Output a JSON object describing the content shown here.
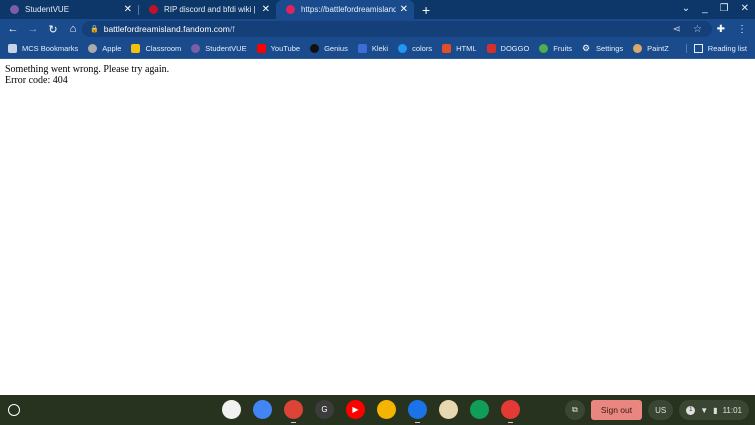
{
  "tabs": [
    {
      "title": "StudentVUE",
      "favicon_color": "#7b5ea7",
      "active": false
    },
    {
      "title": "RIP discord and bfdi wiki | Fandom",
      "favicon_color": "#c0132a",
      "active": false
    },
    {
      "title": "https://battlefordreamisland.fandom.com/f",
      "favicon_color": "#e0245e",
      "active": true
    }
  ],
  "new_tab": "+",
  "omnibox": {
    "host": "battlefordreamisland.fandom.com",
    "path": "/f"
  },
  "bookmarks": [
    {
      "label": "MCS Bookmarks",
      "color": "#c7d4e8"
    },
    {
      "label": "Apple",
      "color": "#aaaaaa"
    },
    {
      "label": "Classroom",
      "color": "#f4c20d"
    },
    {
      "label": "StudentVUE",
      "color": "#7b5ea7"
    },
    {
      "label": "YouTube",
      "color": "#ff0000"
    },
    {
      "label": "Genius",
      "color": "#111111"
    },
    {
      "label": "Kleki",
      "color": "#3b6fd8"
    },
    {
      "label": "colors",
      "color": "#2196f3"
    },
    {
      "label": "HTML",
      "color": "#e44d26"
    },
    {
      "label": "DOGGO",
      "color": "#d32f2f"
    },
    {
      "label": "Fruits",
      "color": "#4caf50"
    },
    {
      "label": "Settings",
      "color": "#ffffff"
    },
    {
      "label": "PaintZ",
      "color": "#d9a86c"
    }
  ],
  "reading_list": "Reading list",
  "error": {
    "message": "Something went wrong. Please try again.",
    "code": "Error code: 404"
  },
  "shelf": {
    "apps": [
      {
        "name": "chrome-remote",
        "color": "#f1f1f1",
        "label": "",
        "running": false
      },
      {
        "name": "docs",
        "color": "#4285f4",
        "label": "",
        "running": false
      },
      {
        "name": "chrome",
        "color": "#db4437",
        "label": "",
        "running": true
      },
      {
        "name": "g-app",
        "color": "#3c3c3c",
        "label": "G",
        "running": false
      },
      {
        "name": "youtube",
        "color": "#ff0000",
        "label": "▶",
        "running": false
      },
      {
        "name": "slides",
        "color": "#f4b400",
        "label": "",
        "running": false
      },
      {
        "name": "files",
        "color": "#1a73e8",
        "label": "",
        "running": true
      },
      {
        "name": "paint",
        "color": "#e8d8b0",
        "label": "",
        "running": false
      },
      {
        "name": "classroom",
        "color": "#0f9d58",
        "label": "",
        "running": false
      },
      {
        "name": "screencast",
        "color": "#e53935",
        "label": "",
        "running": true
      }
    ],
    "sign_out": "Sign out",
    "ime": "US",
    "notifications": "1",
    "time": "11:01"
  }
}
